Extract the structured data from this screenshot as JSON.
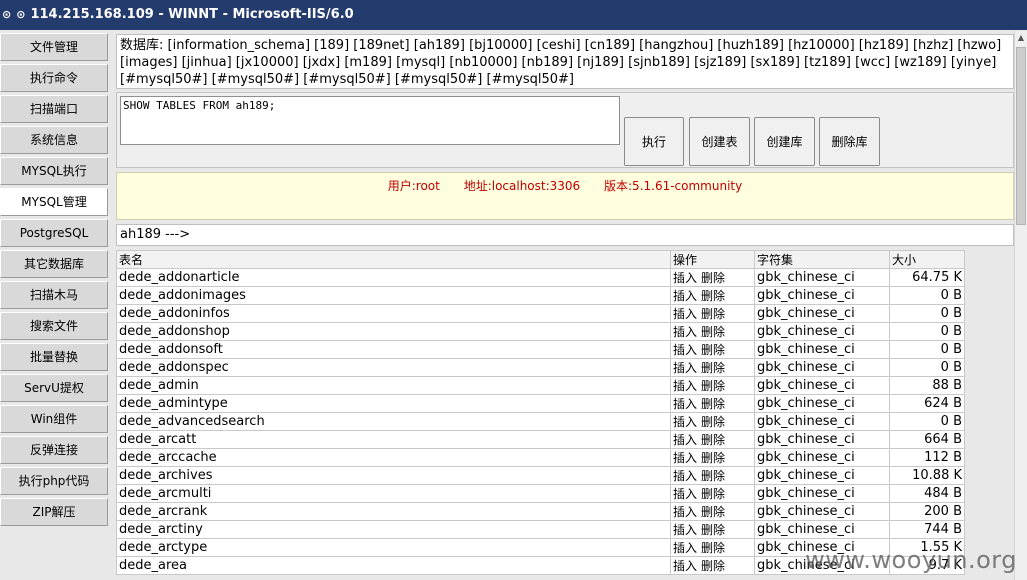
{
  "title": "114.215.168.109 - WINNT - Microsoft-IIS/6.0",
  "titlebar_icons": [
    "⊙",
    "⊙"
  ],
  "sidebar": {
    "items": [
      {
        "label": "文件管理"
      },
      {
        "label": "执行命令"
      },
      {
        "label": "扫描端口"
      },
      {
        "label": "系统信息"
      },
      {
        "label": "MYSQL执行"
      },
      {
        "label": "MYSQL管理"
      },
      {
        "label": "PostgreSQL"
      },
      {
        "label": "其它数据库"
      },
      {
        "label": "扫描木马"
      },
      {
        "label": "搜索文件"
      },
      {
        "label": "批量替换"
      },
      {
        "label": "ServU提权"
      },
      {
        "label": "Win组件"
      },
      {
        "label": "反弹连接"
      },
      {
        "label": "执行php代码"
      },
      {
        "label": "ZIP解压"
      }
    ],
    "active_index": 5
  },
  "databases": {
    "prefix": "数据库:",
    "list": [
      "information_schema",
      "189",
      "189net",
      "ah189",
      "bj10000",
      "ceshi",
      "cn189",
      "hangzhou",
      "huzh189",
      "hz10000",
      "hz189",
      "hzhz",
      "hzwo",
      "images",
      "jinhua",
      "jx10000",
      "jxdx",
      "m189",
      "mysql",
      "nb10000",
      "nb189",
      "nj189",
      "sjnb189",
      "sjz189",
      "sx189",
      "tz189",
      "wcc",
      "wz189",
      "yinye",
      "#mysql50#",
      "#mysql50#",
      "#mysql50#",
      "#mysql50#",
      "#mysql50#"
    ]
  },
  "query": {
    "sql": "SHOW TABLES FROM ah189;",
    "execute_label": "执行",
    "create_table_label": "创建表",
    "create_db_label": "创建库",
    "drop_db_label": "删除库"
  },
  "info": {
    "user": "用户:root",
    "host": "地址:localhost:3306",
    "version": "版本:5.1.61-community"
  },
  "path": "ah189 --->",
  "table": {
    "headers": {
      "name": "表名",
      "ops": "操作",
      "charset": "字符集",
      "size": "大小"
    },
    "insert_label": "插入",
    "delete_label": "删除",
    "rows": [
      {
        "name": "dede_addonarticle",
        "charset": "gbk_chinese_ci",
        "size": "64.75 K"
      },
      {
        "name": "dede_addonimages",
        "charset": "gbk_chinese_ci",
        "size": "0 B"
      },
      {
        "name": "dede_addoninfos",
        "charset": "gbk_chinese_ci",
        "size": "0 B"
      },
      {
        "name": "dede_addonshop",
        "charset": "gbk_chinese_ci",
        "size": "0 B"
      },
      {
        "name": "dede_addonsoft",
        "charset": "gbk_chinese_ci",
        "size": "0 B"
      },
      {
        "name": "dede_addonspec",
        "charset": "gbk_chinese_ci",
        "size": "0 B"
      },
      {
        "name": "dede_admin",
        "charset": "gbk_chinese_ci",
        "size": "88 B"
      },
      {
        "name": "dede_admintype",
        "charset": "gbk_chinese_ci",
        "size": "624 B"
      },
      {
        "name": "dede_advancedsearch",
        "charset": "gbk_chinese_ci",
        "size": "0 B"
      },
      {
        "name": "dede_arcatt",
        "charset": "gbk_chinese_ci",
        "size": "664 B"
      },
      {
        "name": "dede_arccache",
        "charset": "gbk_chinese_ci",
        "size": "112 B"
      },
      {
        "name": "dede_archives",
        "charset": "gbk_chinese_ci",
        "size": "10.88 K"
      },
      {
        "name": "dede_arcmulti",
        "charset": "gbk_chinese_ci",
        "size": "484 B"
      },
      {
        "name": "dede_arcrank",
        "charset": "gbk_chinese_ci",
        "size": "200 B"
      },
      {
        "name": "dede_arctiny",
        "charset": "gbk_chinese_ci",
        "size": "744 B"
      },
      {
        "name": "dede_arctype",
        "charset": "gbk_chinese_ci",
        "size": "1.55 K"
      },
      {
        "name": "dede_area",
        "charset": "gbk_chinese_ci",
        "size": "9.7 K"
      }
    ]
  },
  "watermark": "www.wooyun.org"
}
